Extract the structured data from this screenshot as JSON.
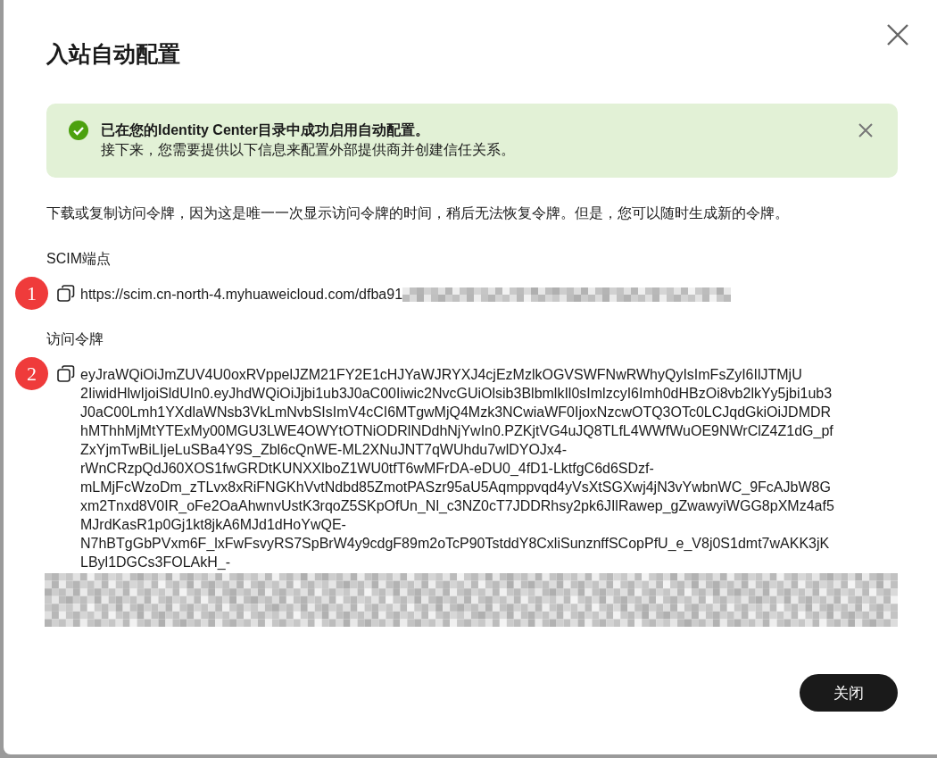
{
  "dialog": {
    "title": "入站自动配置"
  },
  "alert": {
    "kind": "success",
    "title": "已在您的Identity Center目录中成功启用自动配置。",
    "message": "接下来，您需要提供以下信息来配置外部提供商并创建信任关系。"
  },
  "description": "下载或复制访问令牌，因为这是唯一一次显示访问令牌的时间，稍后无法恢复令牌。但是，您可以随时生成新的令牌。",
  "fields": [
    {
      "label": "SCIM端点",
      "marker": "1",
      "lines": [
        "https://scim.cn-north-4.myhuaweicloud.com/dfba91"
      ],
      "kind": "endpoint"
    },
    {
      "label": "访问令牌",
      "marker": "2",
      "lines": [
        "eyJraWQiOiJmZUV4U0oxRVppelJZM21FY2E1cHJYaWJRYXJ4cjEzMzlkOGVSWFNwRWhyQyIsImFsZyI6IlJTMjU",
        "2IiwidHlwIjoiSldUIn0.eyJhdWQiOiJjbi1ub3J0aC00Iiwic2NvcGUiOlsib3BlbmlkIl0sImlzcyI6Imh0dHBzOi8vb2lkYy5jbi1ub3",
        "J0aC00Lmh1YXdlaWNsb3VkLmNvbSIsImV4cCI6MTgwMjQ4Mzk3NCwiaWF0IjoxNzcwOTQ3OTc0LCJqdGkiOiJDMDR",
        "hMThhMjMtYTExMy00MGU3LWE4OWYtOTNiODRlNDdhNjYwIn0.PZKjtVG4uJQ8TLfL4WWfWuOE9NWrClZ4Z1dG_pf",
        "ZxYjmTwBiLIjeLuSBa4Y9S_Zbl6cQnWE-ML2XNuJNT7qWUhdu7wlDYOJx4-",
        "rWnCRzpQdJ60XOS1fwGRDtKUNXXlboZ1WU0tfT6wMFrDA-eDU0_4fD1-LktfgC6d6SDzf-",
        "mLMjFcWzoDm_zTLvx8xRiFNGKhVvtNdbd85ZmotPASzr95aU5Aqmppvqd4yVsXtSGXwj4jN3vYwbnWC_9FcAJbW8G",
        "xm2Tnxd8V0IR_oFe2OaAhwnvUstK3rqoZ5SKpOfUn_Nl_c3NZ0cT7JDDRhsy2pk6JIlRawep_gZwawyiWGG8pXMz4af5",
        "MJrdKasR1p0Gj1kt8jkA6MJd1dHoYwQE-",
        "N7hBTgGbPVxm6F_lxFwFsvyRS7SpBrW4y9cdgF89m2oTcP90TstddY8CxliSunznffSCopPfU_e_V8j0S1dmt7wAKK3jK",
        "LByl1DGCs3FOLAkH_-"
      ],
      "kind": "token"
    }
  ],
  "close_button": "关闭"
}
